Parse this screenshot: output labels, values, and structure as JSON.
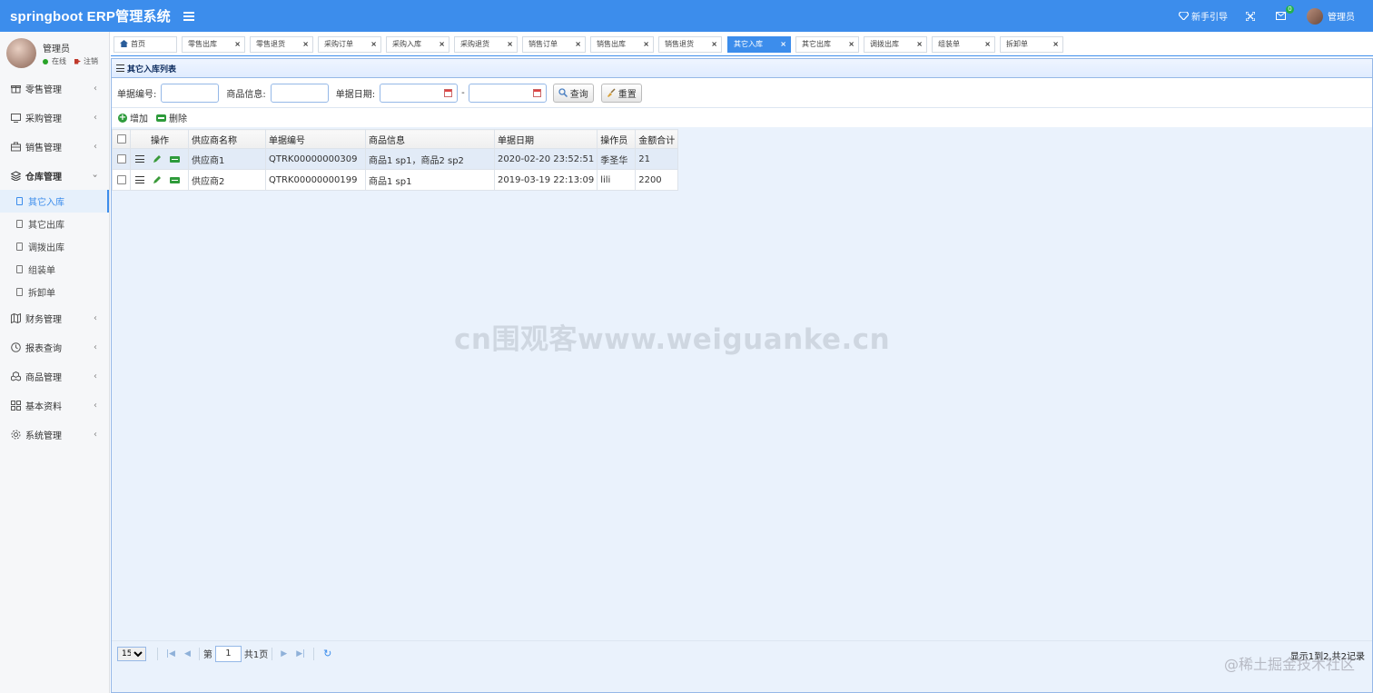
{
  "header": {
    "brand": "springboot ERP管理系统",
    "guide": "新手引导",
    "mail_badge": "0",
    "user": "管理员"
  },
  "sidebar": {
    "user_name": "管理员",
    "status": "在线",
    "logout": "注销",
    "menus": [
      {
        "label": "零售管理"
      },
      {
        "label": "采购管理"
      },
      {
        "label": "销售管理"
      },
      {
        "label": "仓库管理"
      },
      {
        "label": "财务管理"
      },
      {
        "label": "报表查询"
      },
      {
        "label": "商品管理"
      },
      {
        "label": "基本资料"
      },
      {
        "label": "系统管理"
      }
    ],
    "warehouse_sub": [
      "其它入库",
      "其它出库",
      "调拨出库",
      "组装单",
      "拆卸单"
    ]
  },
  "tabs": [
    "首页",
    "零售出库",
    "零售退货",
    "采购订单",
    "采购入库",
    "采购退货",
    "销售订单",
    "销售出库",
    "销售退货",
    "其它入库",
    "其它出库",
    "调拨出库",
    "组装单",
    "拆卸单"
  ],
  "panel": {
    "title": "其它入库列表",
    "search": {
      "doc_no_label": "单据编号:",
      "product_label": "商品信息:",
      "date_label": "单据日期:",
      "dash": "-",
      "query_btn": "查询",
      "reset_btn": "重置"
    },
    "toolbar": {
      "add": "增加",
      "delete": "删除"
    },
    "columns": [
      "操作",
      "供应商名称",
      "单据编号",
      "商品信息",
      "单据日期",
      "操作员",
      "金额合计"
    ],
    "rows": [
      {
        "supplier": "供应商1",
        "doc_no": "QTRK00000000309",
        "products": "商品1 sp1，商品2 sp2",
        "date": "2020-02-20 23:52:51",
        "operator": "季圣华",
        "total": "21"
      },
      {
        "supplier": "供应商2",
        "doc_no": "QTRK00000000199",
        "products": "商品1 sp1",
        "date": "2019-03-19 22:13:09",
        "operator": "lili",
        "total": "2200"
      }
    ],
    "pager": {
      "page_size": "15",
      "page_prefix": "第",
      "page_value": "1",
      "page_total": "共1页",
      "info": "显示1到2,共2记录"
    }
  },
  "watermark": "cn围观客www.weiguanke.cn",
  "corner_watermark": "@稀土掘金技术社区",
  "colors": {
    "primary": "#3c8dec",
    "panel_bg": "#eaf2fc",
    "border": "#95b8e7",
    "green": "#2e9b3b"
  }
}
